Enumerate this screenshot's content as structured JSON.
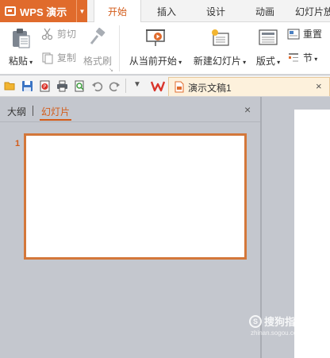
{
  "app": {
    "name": "WPS 演示"
  },
  "tabs": [
    "开始",
    "插入",
    "设计",
    "动画",
    "幻灯片放"
  ],
  "ribbon": {
    "paste": "粘贴",
    "cut": "剪切",
    "copy": "复制",
    "format_painter": "格式刷",
    "from_current": "从当前开始",
    "new_slide": "新建幻灯片",
    "layout": "版式",
    "reset": "重置",
    "section": "节"
  },
  "document": {
    "tab_title": "演示文稿1",
    "close": "×"
  },
  "panel": {
    "tab_outline": "大纲",
    "tab_slides": "幻灯片",
    "close": "×",
    "slide_number": "1"
  },
  "watermark": {
    "text": "搜狗指南",
    "url": "zhinan.sogou.com"
  },
  "colors": {
    "accent": "#d35c1a",
    "app_button": "#e06b2c",
    "thumb_border": "#d3773a"
  }
}
